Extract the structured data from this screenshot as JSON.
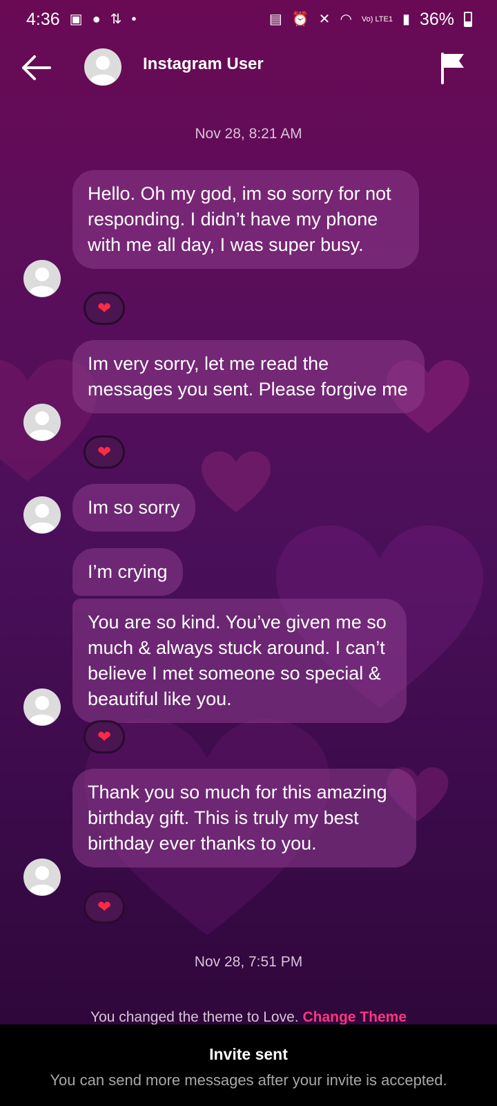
{
  "status_bar": {
    "time": "4:36",
    "battery": "36%",
    "network": "Vo) LTE1"
  },
  "header": {
    "contact_name": "Instagram User",
    "back_icon": "arrow-left-icon",
    "flag_icon": "flag-icon"
  },
  "timestamps": {
    "first": "Nov 28, 8:21 AM",
    "second": "Nov 28, 7:51 PM"
  },
  "messages": [
    {
      "text": "Hello. Oh my god, im so sorry for not responding. I didn’t have my phone with me all day, I was super busy.",
      "reaction": "❤"
    },
    {
      "text": "Im very sorry, let me read the messages you sent. Please forgive me",
      "reaction": "❤"
    },
    {
      "text": "Im so sorry"
    },
    {
      "text": "I’m crying"
    },
    {
      "text": "You are so kind. You’ve given me so much & always stuck around. I can’t believe I met someone so special & beautiful like you.",
      "reaction": "❤"
    },
    {
      "text": "Thank you so much for this amazing birthday gift. This is truly my best birthday ever thanks to you.",
      "reaction": "❤"
    }
  ],
  "theme_note": {
    "text": "You changed the theme to Love.",
    "link": "Change Theme"
  },
  "invite": {
    "title": "Invite sent",
    "subtitle": "You can send more messages after your invite is accepted."
  },
  "colors": {
    "bubble": "#8c3c8c",
    "link": "#ff3580",
    "heart": "#ff2a45"
  }
}
